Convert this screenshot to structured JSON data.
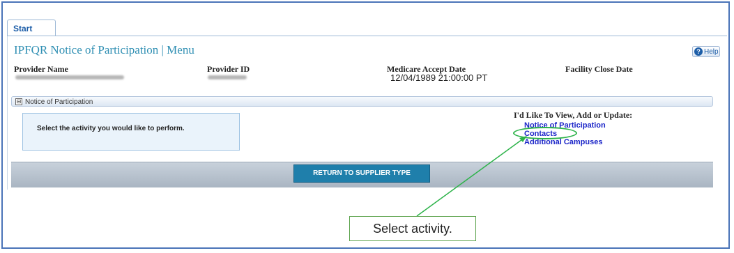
{
  "tabs": [
    {
      "label": "Start"
    }
  ],
  "page_title": "IPFQR Notice of Participation | Menu",
  "help": {
    "label": "Help"
  },
  "provider": {
    "name_label": "Provider Name",
    "id_label": "Provider ID",
    "accept_label": "Medicare Accept Date",
    "accept_value": "12/04/1989 21:00:00 PT",
    "close_label": "Facility Close Date"
  },
  "section": {
    "toggle": "⊟",
    "title": "Notice of Participation"
  },
  "instruction": "Select the activity you would like to perform.",
  "options": {
    "heading": "I'd Like To View, Add or Update:",
    "links": [
      "Notice of Participation",
      "Contacts",
      "Additional Campuses"
    ]
  },
  "return_button": "RETURN TO SUPPLIER TYPE",
  "callout": "Select activity.",
  "colors": {
    "accent": "#2f8fb3",
    "link": "#1b25c8",
    "annotation": "#2db34a",
    "button": "#1f7fab"
  }
}
